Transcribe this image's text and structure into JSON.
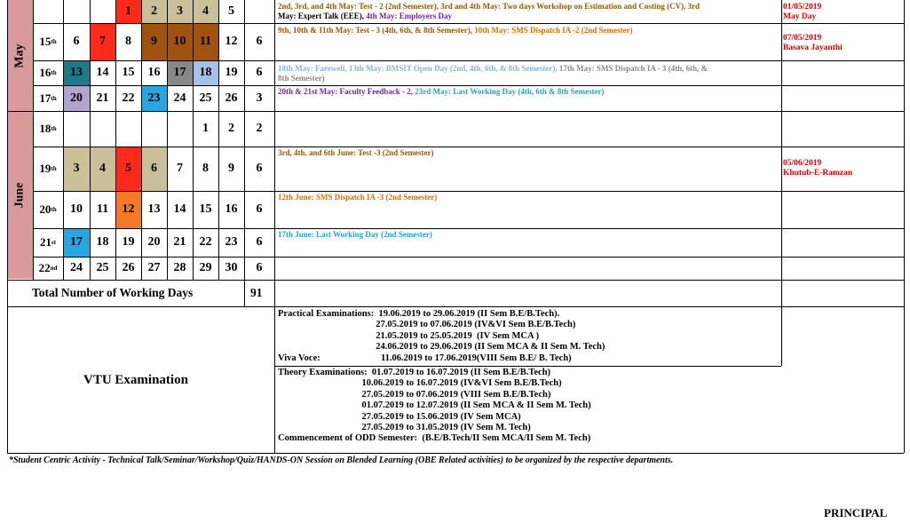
{
  "months": [
    {
      "name": "May",
      "color": "#d89a9a"
    },
    {
      "name": "June",
      "color": "#d89a9a"
    }
  ],
  "colors": {
    "tan": "#c9c09a",
    "red": "#ff2a1a",
    "brown": "#a0520f",
    "teal": "#1e7a88",
    "gray": "#888888",
    "lightblue": "#a6c0e6",
    "lavender": "#b3a4cf",
    "cyan": "#29a6e0",
    "orange": "#f47a28",
    "lightred": "#ff5a4a",
    "brownText": "#9a5a00",
    "orangeText": "#e07000",
    "purpleText": "#7a1fa2",
    "cyanText": "#21a3d6",
    "lightBlueText": "#86b4dc",
    "redText": "#e60000"
  },
  "weeks": [
    {
      "label": "",
      "days": [
        "",
        "",
        "",
        "1",
        "2",
        "3",
        "4",
        "5"
      ],
      "days_colors": [
        null,
        null,
        null,
        "red",
        "tan",
        "tan",
        "tan",
        null
      ],
      "working": ""
    },
    {
      "label": "15",
      "sup": "th",
      "days": [
        "6",
        "7",
        "8",
        "9",
        "10",
        "11",
        "12"
      ],
      "days_colors": [
        null,
        "red",
        null,
        "brown",
        "brown",
        "brown",
        null
      ],
      "working": "6"
    },
    {
      "label": "16",
      "sup": "th",
      "days": [
        "13",
        "14",
        "15",
        "16",
        "17",
        "18",
        "19"
      ],
      "days_colors": [
        "teal",
        null,
        null,
        null,
        "gray",
        "lightblue",
        null
      ],
      "working": "6"
    },
    {
      "label": "17",
      "sup": "th",
      "days": [
        "20",
        "21",
        "22",
        "23",
        "24",
        "25",
        "26"
      ],
      "days_colors": [
        "lavender",
        null,
        null,
        "cyan",
        null,
        null,
        null
      ],
      "working": "3"
    },
    {
      "label": "18",
      "sup": "th",
      "days": [
        "",
        "",
        "",
        "",
        "",
        "1",
        "2"
      ],
      "days_colors": [
        null,
        null,
        null,
        null,
        null,
        null,
        null
      ],
      "working": "2"
    },
    {
      "label": "19",
      "sup": "th",
      "days": [
        "3",
        "4",
        "5",
        "6",
        "7",
        "8",
        "9"
      ],
      "days_colors": [
        "tan",
        "tan",
        "red",
        "tan",
        null,
        null,
        null
      ],
      "working": "6"
    },
    {
      "label": "20",
      "sup": "th",
      "days": [
        "10",
        "11",
        "12",
        "13",
        "14",
        "15",
        "16"
      ],
      "days_colors": [
        null,
        null,
        "orange",
        null,
        null,
        null,
        null
      ],
      "working": "6"
    },
    {
      "label": "21",
      "sup": "st",
      "days": [
        "17",
        "18",
        "19",
        "20",
        "21",
        "22",
        "23"
      ],
      "days_colors": [
        "cyan",
        null,
        null,
        null,
        null,
        null,
        null
      ],
      "working": "6"
    },
    {
      "label": "22",
      "sup": "nd",
      "days": [
        "24",
        "25",
        "26",
        "27",
        "28",
        "29",
        "30"
      ],
      "days_colors": [
        null,
        null,
        null,
        null,
        null,
        null,
        null
      ],
      "working": "6"
    }
  ],
  "events": {
    "r0_a": "2nd, 3rd, and 4th May: Test - 2 (2nd Semester), 3rd and 4th May: Two days Workshop on Estimation and Costing (CV), 3rd",
    "r0_b1": "May: Expert Talk (EEE), ",
    "r0_b2": "4th May: Employers Day",
    "r1_a": "9th, 10th & 11th May: Test - 3 (4th, 6th, & 8th Semester), ",
    "r1_b": "10th May: SMS Dispatch IA -2 (2nd Semester)",
    "r2_a": "18th May: Farewell, 13th May: BMSIT Open Day (2nd, 4th, 6th, & 8th Semester), ",
    "r2_b": "17th May: SMS Dispatch IA - 3 (4th, 6th, &",
    "r2_c": "8th Semester)",
    "r3_a": "20th & 21st May: Faculty Feedback - 2, ",
    "r3_b": "23rd May: Last Working Day (4th, 6th & 8th Semester)",
    "r5": "3rd, 4th, and 6th June: Test -3 (2nd Semester)",
    "r6": "12th June: SMS Dispatch IA -3 (2nd Semester)",
    "r7": "17th June: Last Working Day (2nd Semester)"
  },
  "holidays": {
    "h0_date": "01/05/2019",
    "h0_name": "May Day",
    "h1_date": "07/05/2019",
    "h1_name": "Basava Jayanthi",
    "h5_date": "05/06/2019",
    "h5_name": "Khutub-E-Ramzan"
  },
  "total": {
    "label": "Total Number of Working Days",
    "value": "91"
  },
  "vtu": {
    "title": "VTU Examination",
    "practical": [
      "Practical Examinations:  19.06.2019 to 29.06.2019 (II Sem B.E/B.Tech).",
      "                                          27.05.2019 to 07.06.2019 (IV&VI Sem B.E/B.Tech)",
      "                                          21.05.2019 to 25.05.2019  (IV Sem MCA )",
      "                                          24.06.2019 to 29.06.2019 (II Sem MCA & II Sem M. Tech)",
      "Viva Voce:                          11.06.2019 to 17.06.2019(VIII Sem B.E/ B. Tech)"
    ],
    "theory": [
      "Theory Examinations:  01.07.2019 to 16.07.2019 (II Sem B.E/B.Tech)",
      "                                    10.06.2019 to 16.07.2019 (IV&VI Sem B.E/B.Tech)",
      "                                    27.05.2019 to 07.06.2019 (VIII Sem B.E/B.Tech)",
      "                                    01.07.2019 to 12.07.2019 (II Sem MCA & II Sem M. Tech)",
      "                                    27.05.2019 to 15.06.2019 (IV Sem MCA)",
      "                                    27.05.2019 to 31.05.2019 (IV Sem M. Tech)",
      "Commencement of ODD Semester:  (B.E/B.Tech/II Sem MCA/II Sem M. Tech)"
    ]
  },
  "footnote": "*Student Centric Activity -  Technical Talk/Seminar/Workshop/Quiz/HANDS-ON Session on Blended Learning (OBE Related activities) to be organized by the respective departments.",
  "signature": "PRINCIPAL"
}
